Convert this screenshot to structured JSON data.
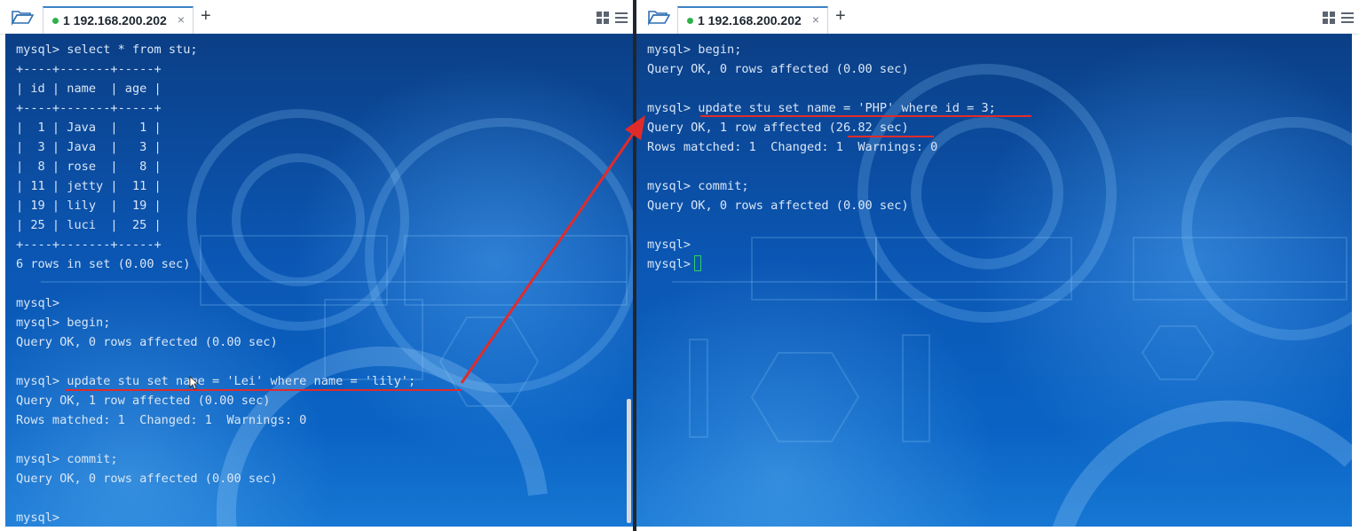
{
  "left_pane": {
    "tab_title": "1 192.168.200.202",
    "close_glyph": "×",
    "add_tab_glyph": "+",
    "lines": [
      "mysql> select * from stu;",
      "+----+-------+-----+",
      "| id | name  | age |",
      "+----+-------+-----+",
      "|  1 | Java  |   1 |",
      "|  3 | Java  |   3 |",
      "|  8 | rose  |   8 |",
      "| 11 | jetty |  11 |",
      "| 19 | lily  |  19 |",
      "| 25 | luci  |  25 |",
      "+----+-------+-----+",
      "6 rows in set (0.00 sec)",
      "",
      "mysql>",
      "mysql> begin;",
      "Query OK, 0 rows affected (0.00 sec)",
      "",
      "mysql> update stu set name = 'Lei' where name = 'lily';",
      "Query OK, 1 row affected (0.00 sec)",
      "Rows matched: 1  Changed: 1  Warnings: 0",
      "",
      "mysql> commit;",
      "Query OK, 0 rows affected (0.00 sec)",
      "",
      "mysql>"
    ]
  },
  "right_pane": {
    "tab_title": "1 192.168.200.202",
    "close_glyph": "×",
    "add_tab_glyph": "+",
    "lines": [
      "mysql> begin;",
      "Query OK, 0 rows affected (0.00 sec)",
      "",
      "mysql> update stu set name = 'PHP' where id = 3;",
      "Query OK, 1 row affected (26.82 sec)",
      "Rows matched: 1  Changed: 1  Warnings: 0",
      "",
      "mysql> commit;",
      "Query OK, 0 rows affected (0.00 sec)",
      "",
      "mysql>",
      "mysql>"
    ]
  },
  "colors": {
    "annotation": "#e02b2b",
    "terminal_text": "#d9e6f5",
    "cursor": "#2fcf63",
    "tab_active_dot": "#2db14a"
  },
  "icons": [
    "folder-icon",
    "close-icon",
    "plus-icon",
    "layout-grid-icon",
    "menu-icon",
    "mouse-cursor-icon",
    "annotation-arrow"
  ]
}
